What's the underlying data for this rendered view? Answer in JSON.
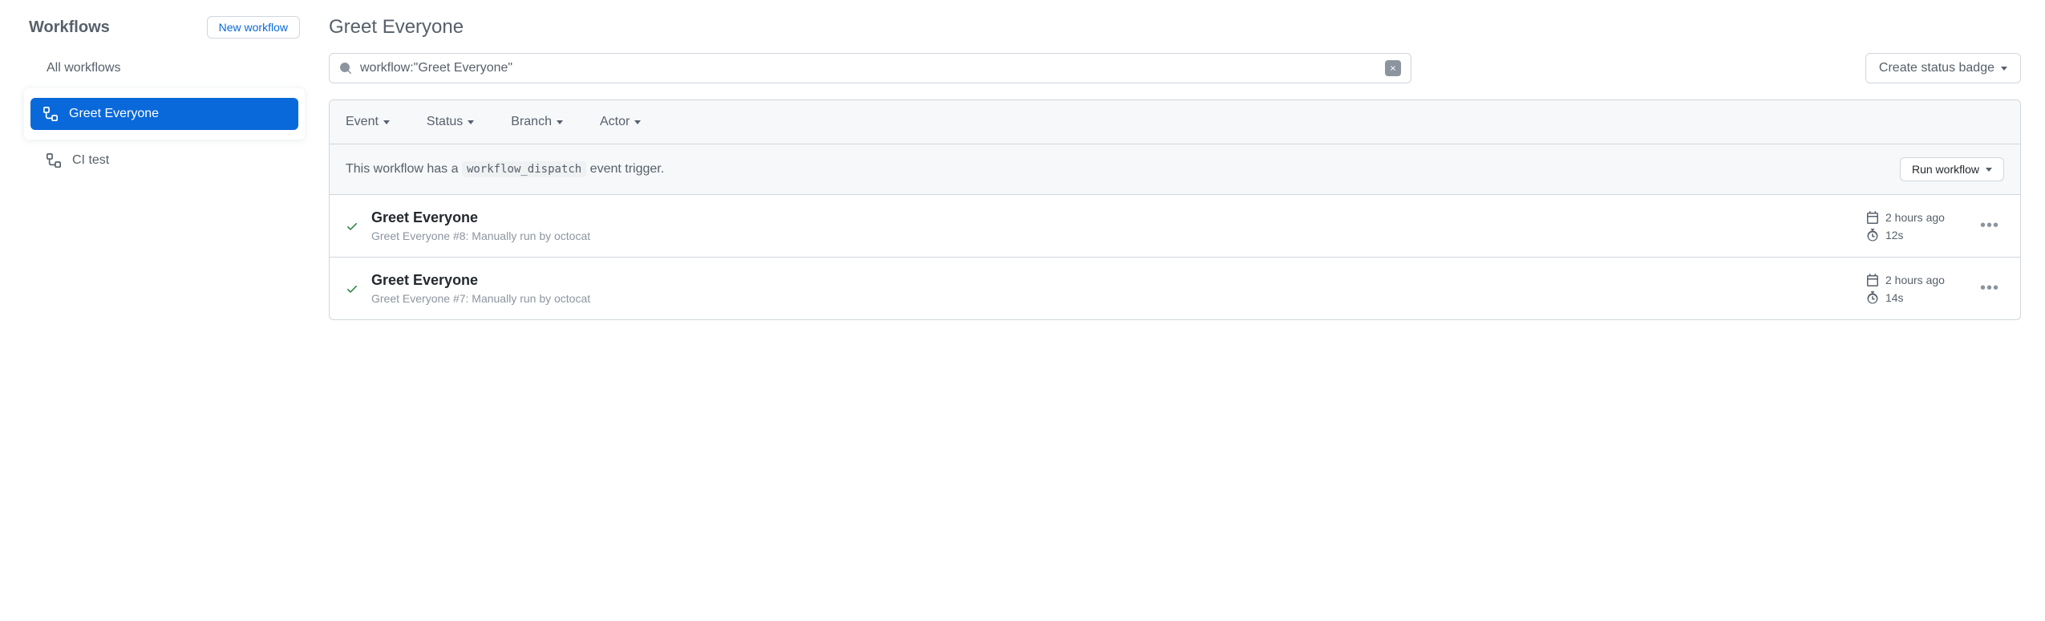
{
  "sidebar": {
    "title": "Workflows",
    "new_button": "New workflow",
    "all_workflows": "All workflows",
    "items": [
      {
        "label": "Greet Everyone",
        "active": true
      },
      {
        "label": "CI test",
        "active": false
      }
    ]
  },
  "main": {
    "title": "Greet Everyone",
    "search_value": "workflow:\"Greet Everyone\"",
    "status_badge_button": "Create status badge",
    "filters": {
      "event": "Event",
      "status": "Status",
      "branch": "Branch",
      "actor": "Actor"
    },
    "dispatch": {
      "prefix": "This workflow has a ",
      "code": "workflow_dispatch",
      "suffix": " event trigger.",
      "run_button": "Run workflow"
    },
    "runs": [
      {
        "title": "Greet Everyone",
        "subtitle": "Greet Everyone #8: Manually run by octocat",
        "time": "2 hours ago",
        "duration": "12s"
      },
      {
        "title": "Greet Everyone",
        "subtitle": "Greet Everyone #7: Manually run by octocat",
        "time": "2 hours ago",
        "duration": "14s"
      }
    ]
  }
}
